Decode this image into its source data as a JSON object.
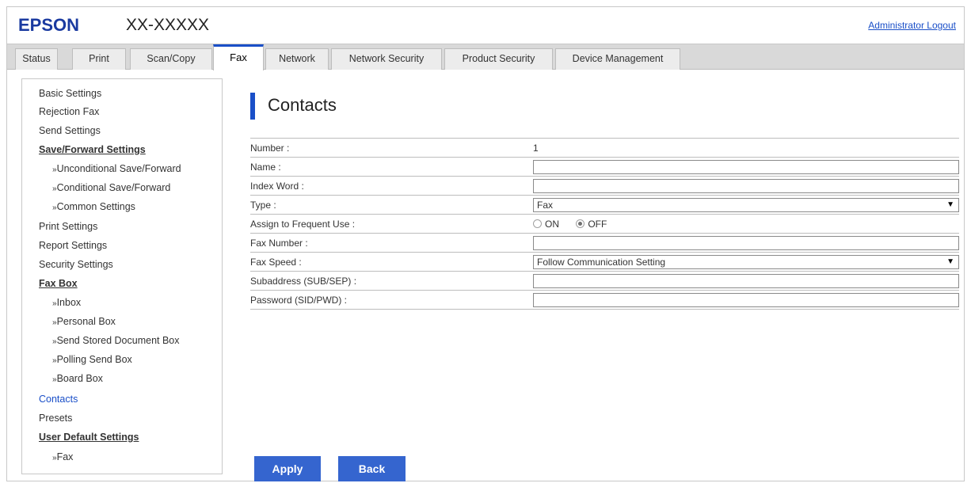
{
  "header": {
    "brand": "EPSON",
    "model": "XX-XXXXX",
    "admin_logout": "Administrator Logout"
  },
  "tabs": [
    {
      "label": "Status"
    },
    {
      "label": "Print"
    },
    {
      "label": "Scan/Copy"
    },
    {
      "label": "Fax"
    },
    {
      "label": "Network"
    },
    {
      "label": "Network Security"
    },
    {
      "label": "Product Security"
    },
    {
      "label": "Device Management"
    }
  ],
  "active_tab": "Fax",
  "sidebar": {
    "items": [
      {
        "label": "Basic Settings"
      },
      {
        "label": "Rejection Fax"
      },
      {
        "label": "Send Settings"
      },
      {
        "label": "Save/Forward Settings"
      },
      {
        "label": "Unconditional Save/Forward"
      },
      {
        "label": "Conditional Save/Forward"
      },
      {
        "label": "Common Settings"
      },
      {
        "label": "Print Settings"
      },
      {
        "label": "Report Settings"
      },
      {
        "label": "Security Settings"
      },
      {
        "label": "Fax Box"
      },
      {
        "label": "Inbox"
      },
      {
        "label": "Personal Box"
      },
      {
        "label": "Send Stored Document Box"
      },
      {
        "label": "Polling Send Box"
      },
      {
        "label": "Board Box"
      },
      {
        "label": "Contacts"
      },
      {
        "label": "Presets"
      },
      {
        "label": "User Default Settings"
      },
      {
        "label": "Fax"
      }
    ],
    "sub_marker": "»"
  },
  "main": {
    "title": "Contacts",
    "fields": {
      "number": {
        "label": "Number :",
        "value": "1"
      },
      "name": {
        "label": "Name :",
        "value": ""
      },
      "index_word": {
        "label": "Index Word :",
        "value": ""
      },
      "type": {
        "label": "Type :",
        "value": "Fax"
      },
      "frequent_use": {
        "label": "Assign to Frequent Use :",
        "on_label": "ON",
        "off_label": "OFF",
        "selected": "OFF"
      },
      "fax_number": {
        "label": "Fax Number :",
        "value": ""
      },
      "fax_speed": {
        "label": "Fax Speed :",
        "value": "Follow Communication Setting"
      },
      "subaddress": {
        "label": "Subaddress (SUB/SEP) :",
        "value": ""
      },
      "password": {
        "label": "Password (SID/PWD) :",
        "value": ""
      }
    },
    "apply_label": "Apply",
    "back_label": "Back"
  },
  "colors": {
    "brand_blue": "#1a3aa0",
    "accent_blue": "#1a4fc8",
    "button_blue": "#3565cf"
  }
}
